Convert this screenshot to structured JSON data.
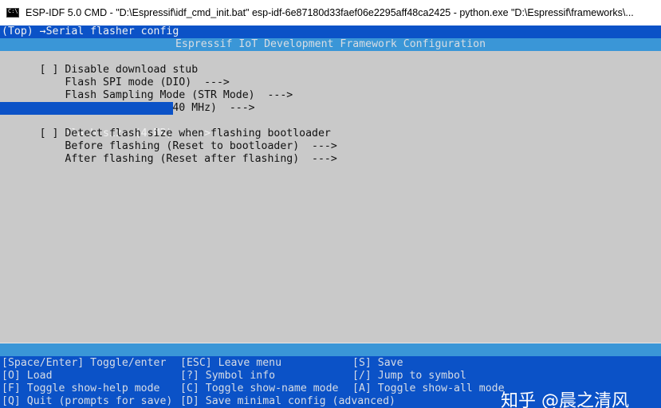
{
  "window": {
    "title": "ESP-IDF 5.0 CMD - \"D:\\Espressif\\idf_cmd_init.bat\"  esp-idf-6e87180d33faef06e2295aff48ca2425 - python.exe  \"D:\\Espressif\\frameworks\\...",
    "icon": "cmd-icon"
  },
  "breadcrumb": "(Top) →Serial flasher config",
  "panel_title": "Espressif IoT Development Framework Configuration",
  "menu_items": [
    {
      "text": "[ ] Disable download stub"
    },
    {
      "text": "    Flash SPI mode (DIO)  --->"
    },
    {
      "text": "    Flash Sampling Mode (STR Mode)  --->"
    },
    {
      "text": "    Flash SPI speed (40 MHz)  --->"
    },
    {
      "text": "    Flash size (4 MB)  --->",
      "selected": true
    },
    {
      "text": "[ ] Detect flash size when flashing bootloader"
    },
    {
      "text": "    Before flashing (Reset to bootloader)  --->"
    },
    {
      "text": "    After flashing (Reset after flashing)  --->"
    }
  ],
  "help": {
    "col1": [
      "[Space/Enter] Toggle/enter",
      "[O] Load",
      "[F] Toggle show-help mode",
      "[Q] Quit (prompts for save)"
    ],
    "col2": [
      "[ESC] Leave menu",
      "[?] Symbol info",
      "[C] Toggle show-name mode",
      "[D] Save minimal config (advanced)"
    ],
    "col3": [
      "[S] Save",
      "[/] Jump to symbol",
      "[A] Toggle show-all mode",
      ""
    ]
  },
  "watermark": "知乎 @晨之清风",
  "colors": {
    "terminal_bg": "#0b52c7",
    "panel_bg": "#c9c9c9",
    "accent_bar": "#3a96d7"
  }
}
